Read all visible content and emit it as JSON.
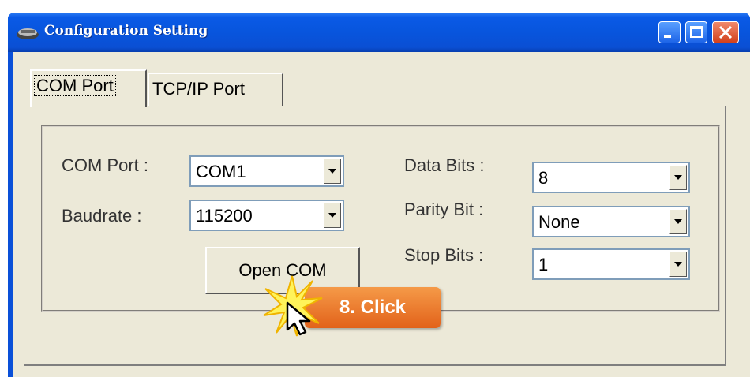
{
  "window": {
    "title": "Configuration Setting"
  },
  "tabs": [
    {
      "label": "COM Port"
    },
    {
      "label": "TCP/IP Port"
    }
  ],
  "settings": {
    "com_port": {
      "label": "COM Port :",
      "value": "COM1"
    },
    "baudrate": {
      "label": "Baudrate :",
      "value": "115200"
    },
    "data_bits": {
      "label": "Data Bits :",
      "value": "8"
    },
    "parity_bit": {
      "label": "Parity Bit :",
      "value": "None"
    },
    "stop_bits": {
      "label": "Stop Bits :",
      "value": "1"
    },
    "open_com_label": "Open COM"
  },
  "annotation": {
    "text": "8. Click"
  },
  "colors": {
    "titlebar": "#0855dd",
    "client": "#ece9d8",
    "callout": "#e8742a"
  }
}
